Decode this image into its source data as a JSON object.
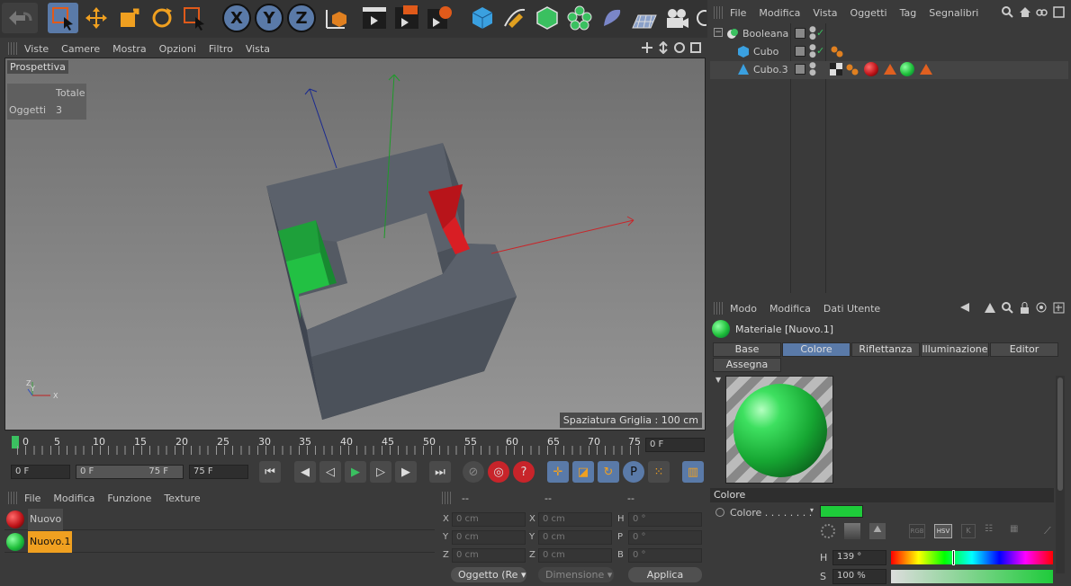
{
  "viewport": {
    "menu": [
      "Viste",
      "Camere",
      "Mostra",
      "Opzioni",
      "Filtro",
      "Vista"
    ],
    "title": "Prospettiva",
    "stats": {
      "header": "Totale",
      "label": "Oggetti",
      "value": "3"
    },
    "grid_label": "Spaziatura Griglia : 100 cm"
  },
  "toolbar": {
    "axes": [
      "X",
      "Y",
      "Z"
    ]
  },
  "timeline": {
    "ticks": [
      "0",
      "5",
      "10",
      "15",
      "20",
      "25",
      "30",
      "35",
      "40",
      "45",
      "50",
      "55",
      "60",
      "65",
      "70",
      "75"
    ],
    "current": "0 F",
    "start": "0 F",
    "range_start": "0 F",
    "range_end": "75 F",
    "end": "75 F"
  },
  "material_manager": {
    "menu": [
      "File",
      "Modifica",
      "Funzione",
      "Texture"
    ],
    "materials": [
      {
        "name": "Nuovo",
        "color": "#c0151a"
      },
      {
        "name": "Nuovo.1",
        "color": "#1fbf3a"
      }
    ]
  },
  "coordinates": {
    "headers": [
      "--",
      "--",
      "--"
    ],
    "rows": [
      {
        "l1": "X",
        "v1": "0 cm",
        "l2": "X",
        "v2": "0 cm",
        "l3": "H",
        "v3": "0 °"
      },
      {
        "l1": "Y",
        "v1": "0 cm",
        "l2": "Y",
        "v2": "0 cm",
        "l3": "P",
        "v3": "0 °"
      },
      {
        "l1": "Z",
        "v1": "0 cm",
        "l2": "Z",
        "v2": "0 cm",
        "l3": "B",
        "v3": "0 °"
      }
    ],
    "mode": "Oggetto (Re",
    "size_mode": "Dimensione",
    "apply": "Applica"
  },
  "object_manager": {
    "menu": [
      "File",
      "Modifica",
      "Vista",
      "Oggetti",
      "Tag",
      "Segnalibri"
    ],
    "objects": [
      {
        "name": "Booleana",
        "icon": "boolean-icon"
      },
      {
        "name": "Cubo",
        "icon": "cube-icon"
      },
      {
        "name": "Cubo.3",
        "icon": "polygon-icon"
      }
    ]
  },
  "attributes": {
    "menu": [
      "Modo",
      "Modifica",
      "Dati Utente"
    ],
    "title": "Materiale [Nuovo.1]",
    "tabs": [
      "Base",
      "Colore",
      "Riflettanza",
      "Illuminazione",
      "Editor"
    ],
    "tab2": "Assegna",
    "active_tab": "Colore",
    "section": "Colore",
    "color_label": "Colore . . . . . . . .",
    "color_value": "#1ecb3a",
    "mode_buttons": [
      "RGB",
      "HSV",
      "K"
    ],
    "h_label": "H",
    "h_value": "139 °",
    "s_label": "S",
    "s_value": "100 %"
  }
}
